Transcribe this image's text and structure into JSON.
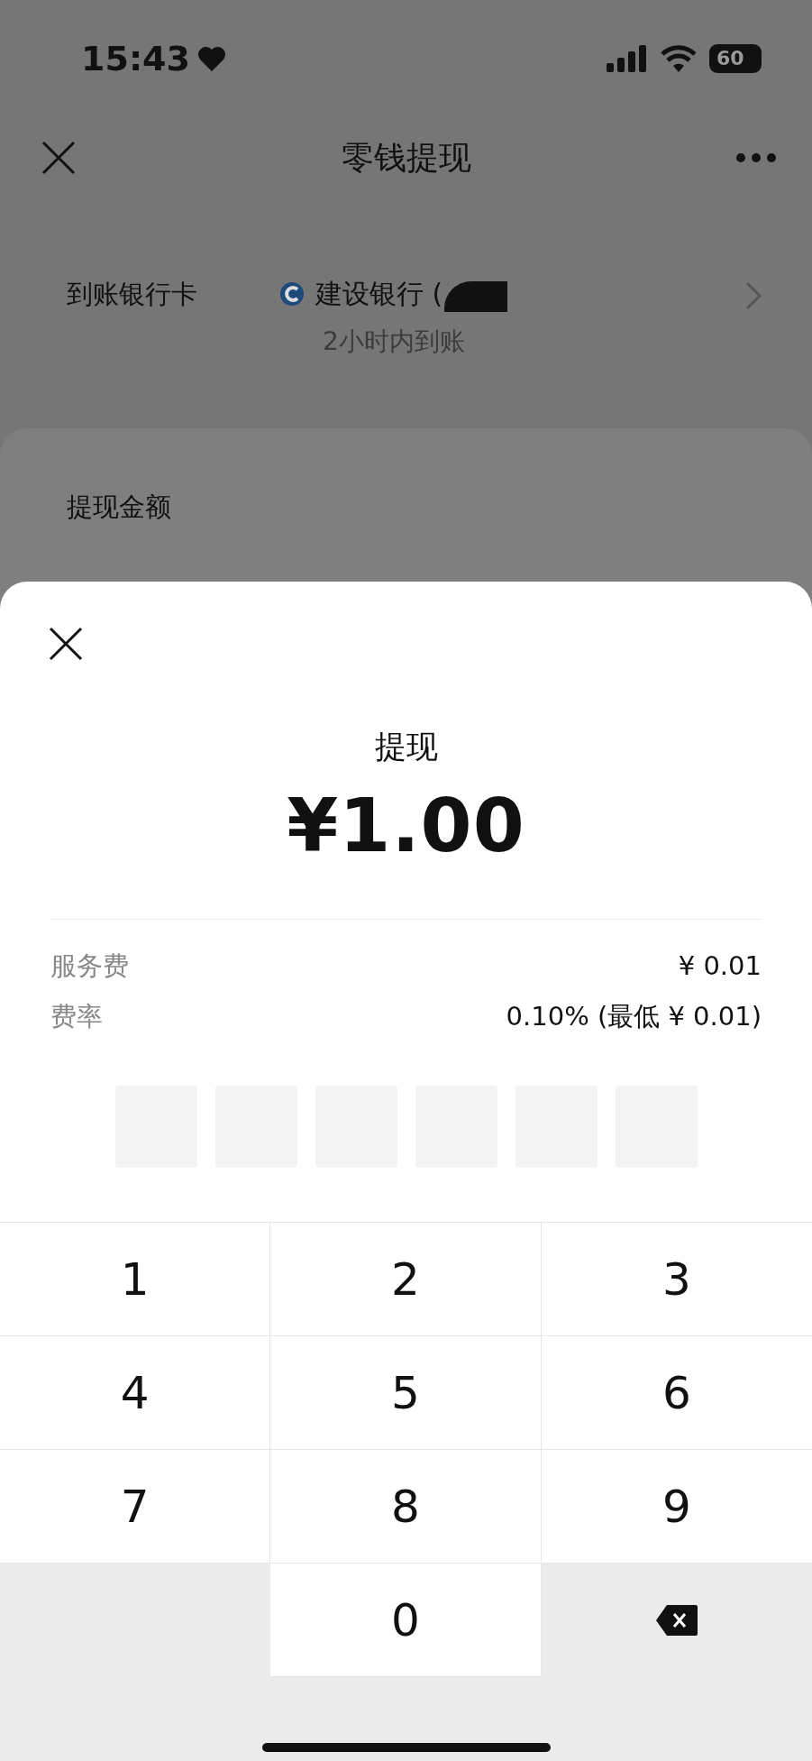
{
  "status_bar": {
    "time": "15:43",
    "battery": "60"
  },
  "nav": {
    "title": "零钱提现"
  },
  "bank_row": {
    "label": "到账银行卡",
    "bank": "建设银行 (",
    "arrival": "2小时内到账"
  },
  "amount_card": {
    "label": "提现金额"
  },
  "sheet": {
    "title": "提现",
    "amount": "¥1.00",
    "fees": [
      {
        "label": "服务费",
        "value": "¥ 0.01"
      },
      {
        "label": "费率",
        "value": "0.10% (最低 ¥ 0.01)"
      }
    ],
    "pin_boxes": [
      {
        "filled": false
      },
      {
        "filled": false
      },
      {
        "filled": false
      },
      {
        "filled": false
      },
      {
        "filled": false
      },
      {
        "filled": false
      }
    ]
  },
  "keypad": [
    {
      "kind": "digit",
      "label": "1"
    },
    {
      "kind": "digit",
      "label": "2"
    },
    {
      "kind": "digit",
      "label": "3"
    },
    {
      "kind": "digit",
      "label": "4"
    },
    {
      "kind": "digit",
      "label": "5"
    },
    {
      "kind": "digit",
      "label": "6"
    },
    {
      "kind": "digit",
      "label": "7"
    },
    {
      "kind": "digit",
      "label": "8"
    },
    {
      "kind": "digit",
      "label": "9"
    },
    {
      "kind": "blank"
    },
    {
      "kind": "digit",
      "label": "0"
    },
    {
      "kind": "delete"
    }
  ]
}
